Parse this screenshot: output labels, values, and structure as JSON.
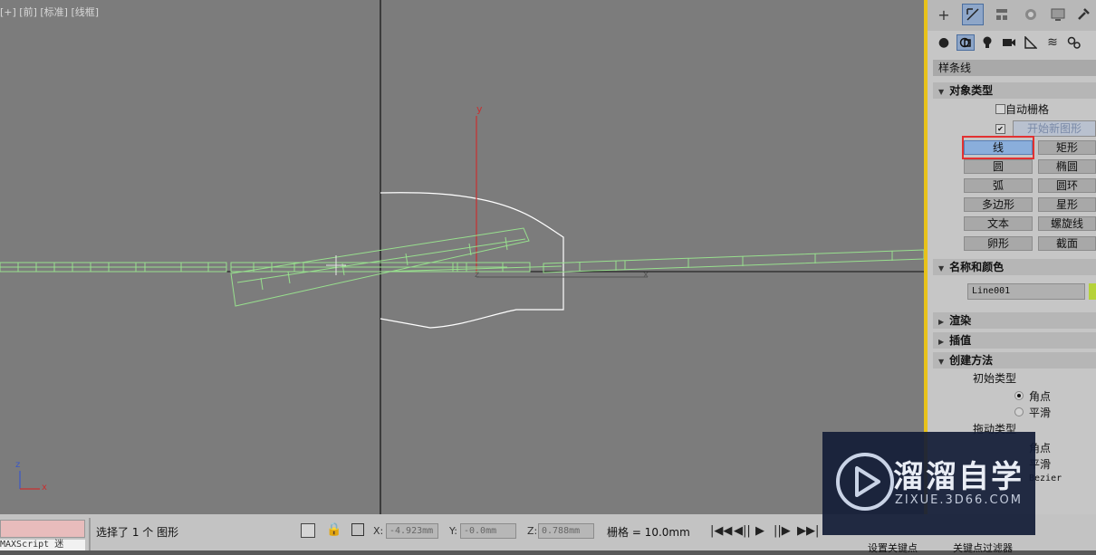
{
  "viewport": {
    "label": "[+] [前] [标准] [线框]",
    "axis_y": "y",
    "axis_x": "x",
    "axis_z": "z",
    "tripod_z": "z",
    "tripod_x": "x"
  },
  "command_panel": {
    "tabs": [
      "create",
      "modify",
      "hierarchy",
      "motion",
      "display",
      "utilities"
    ],
    "active_tab": "modify",
    "subtabs": [
      "geometry",
      "shapes",
      "lights",
      "cameras",
      "helpers",
      "spacewarps",
      "systems"
    ],
    "active_subtab": "shapes",
    "category": "样条线",
    "object_type": {
      "title": "对象类型",
      "autogrid_label": "自动栅格",
      "autogrid_checked": false,
      "start_new_shape_checked": true,
      "start_new_shape_label": "开始新图形",
      "buttons": [
        [
          "线",
          "矩形"
        ],
        [
          "圆",
          "椭圆"
        ],
        [
          "弧",
          "圆环"
        ],
        [
          "多边形",
          "星形"
        ],
        [
          "文本",
          "螺旋线"
        ],
        [
          "卵形",
          "截面"
        ]
      ],
      "selected": "线"
    },
    "name_color": {
      "title": "名称和颜色",
      "name": "Line001",
      "color": "#b6d23a"
    },
    "rollouts_collapsed": [
      "渲染",
      "插值"
    ],
    "creation_method": {
      "title": "创建方法",
      "initial_type_label": "初始类型",
      "initial_options": [
        "角点",
        "平滑"
      ],
      "initial_selected": "角点",
      "drag_type_label": "拖动类型",
      "drag_options": [
        "角点",
        "平滑",
        "Bezier"
      ]
    }
  },
  "status": {
    "maxscript": "MAXScript 迷",
    "selection": "选择了 1 个 图形",
    "x_label": "X:",
    "x_value": "-4.923mm",
    "y_label": "Y:",
    "y_value": "-0.0mm",
    "z_label": "Z:",
    "z_value": "0.788mm",
    "grid": "栅格 = 10.0mm",
    "set_key": "设置关键点",
    "key_filters": "关键点过滤器"
  },
  "watermark": {
    "brand": "溜溜自学",
    "url": "ZIXUE.3D66.COM"
  },
  "colors": {
    "viewport_bg": "#7c7c7c",
    "spline_green": "#98e08e",
    "shape_white": "#ffffff",
    "axis_red": "#c83030",
    "highlight_red": "#e23131",
    "panel_border": "#e8c21a"
  }
}
